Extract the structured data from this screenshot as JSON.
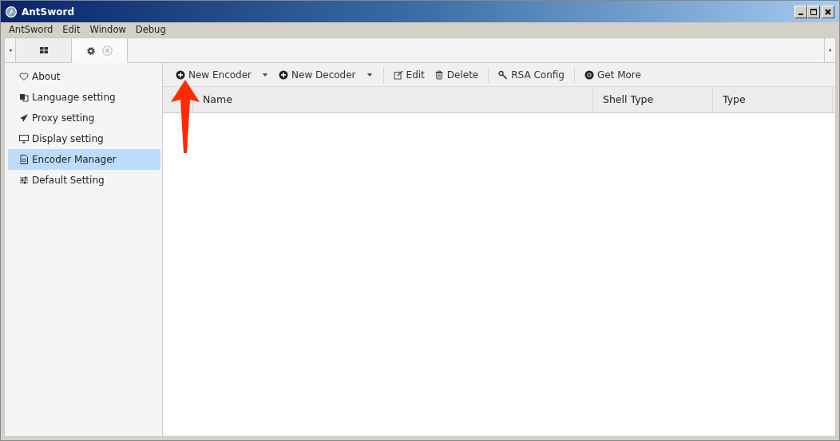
{
  "window": {
    "title": "AntSword"
  },
  "menu": [
    "AntSword",
    "Edit",
    "Window",
    "Debug"
  ],
  "tabs": [
    {
      "kind": "grid",
      "selected": false
    },
    {
      "kind": "settings",
      "selected": true
    }
  ],
  "sidebar": {
    "items": [
      {
        "label": "About",
        "selected": false
      },
      {
        "label": "Language setting",
        "selected": false
      },
      {
        "label": "Proxy setting",
        "selected": false
      },
      {
        "label": "Display setting",
        "selected": false
      },
      {
        "label": "Encoder Manager",
        "selected": true
      },
      {
        "label": "Default Setting",
        "selected": false
      }
    ]
  },
  "toolbar": [
    {
      "kind": "dropdown",
      "label": "New Encoder"
    },
    {
      "kind": "dropdown",
      "label": "New Decoder"
    },
    {
      "kind": "separator"
    },
    {
      "kind": "button",
      "label": "Edit"
    },
    {
      "kind": "button",
      "label": "Delete"
    },
    {
      "kind": "separator"
    },
    {
      "kind": "button",
      "label": "RSA Config"
    },
    {
      "kind": "separator"
    },
    {
      "kind": "button",
      "label": "Get More"
    }
  ],
  "table": {
    "columns": [
      "Name",
      "Shell Type",
      "Type"
    ]
  }
}
